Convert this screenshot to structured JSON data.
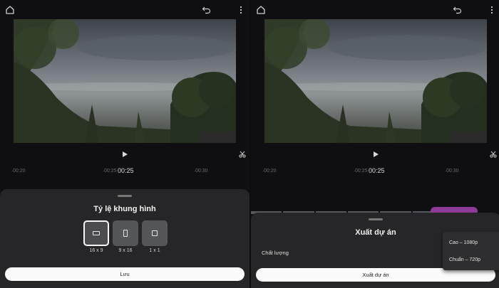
{
  "left_screen": {
    "timeline": {
      "t1": "00:20",
      "t2": "00:25",
      "current": "00:25",
      "t3": "00:30"
    },
    "sheet": {
      "title": "Tỷ lệ khung hình",
      "options": [
        {
          "label": "16 x 9",
          "selected": true
        },
        {
          "label": "9 x 16",
          "selected": false
        },
        {
          "label": "1 x 1",
          "selected": false
        }
      ],
      "save_label": "Lưu"
    }
  },
  "right_screen": {
    "timeline": {
      "t1": "00:20",
      "t2": "00:25",
      "current": "00:25",
      "t3": "00:30"
    },
    "sheet": {
      "title": "Xuất dự án",
      "quality_label": "Chất lượng",
      "export_label": "Xuất dự án"
    },
    "quality_menu": {
      "options": [
        "Cao – 1080p",
        "Chuẩn – 720p"
      ]
    }
  },
  "icons": {
    "home": "home-icon",
    "undo": "undo-icon",
    "more": "more-vertical-icon",
    "play": "play-icon",
    "cut": "scissors-icon"
  },
  "colors": {
    "background": "#0f0f11",
    "sheet": "#262628",
    "button": "#fbfbfb",
    "accent_purple": "#8e3b97"
  }
}
